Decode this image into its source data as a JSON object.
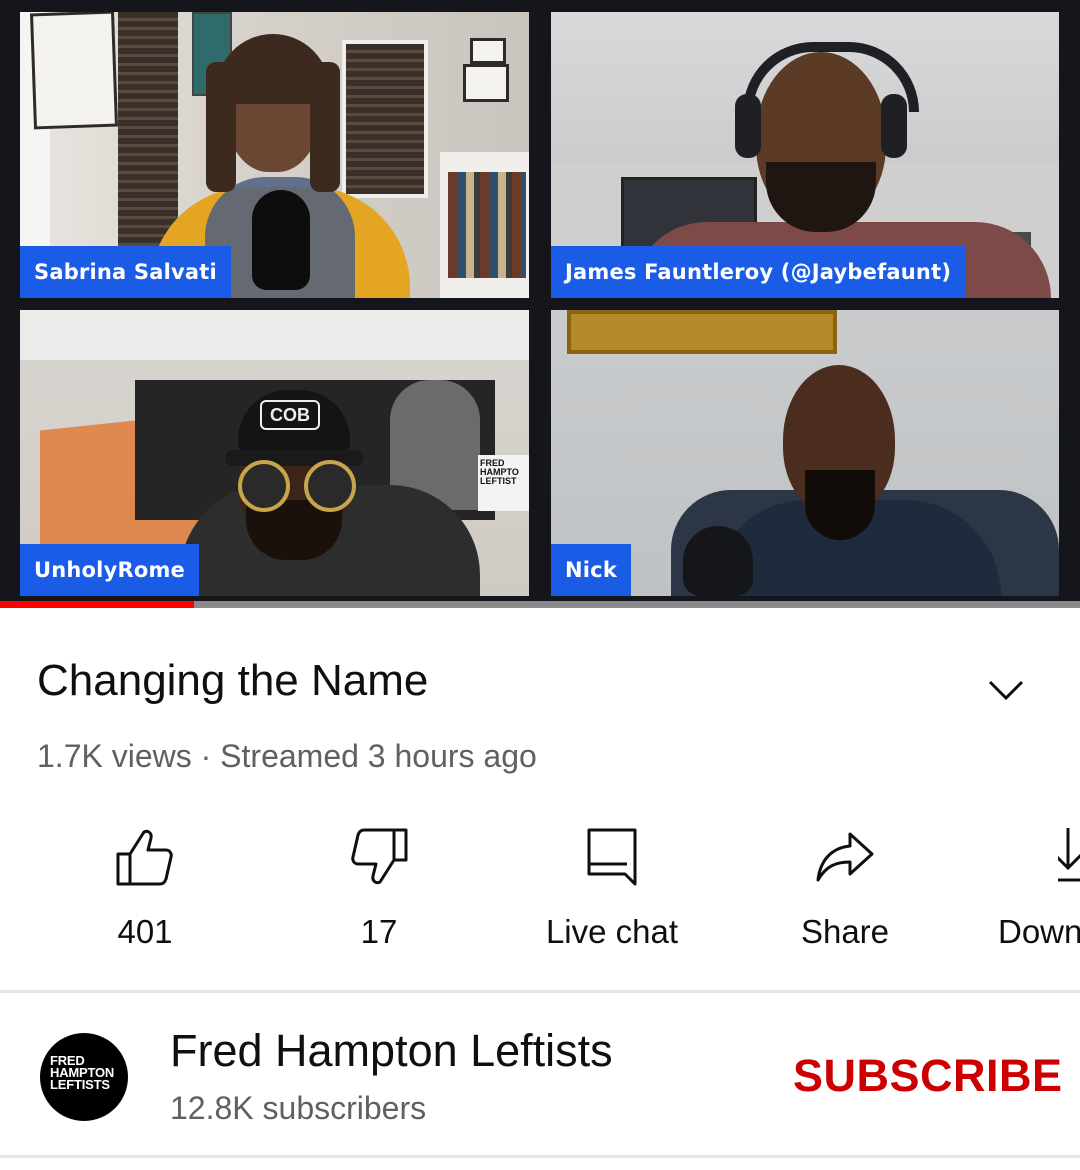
{
  "video": {
    "participants": [
      {
        "name": "Sabrina Salvati"
      },
      {
        "name": "James Fauntleroy (@Jaybefaunt)"
      },
      {
        "name": "UnholyRome"
      },
      {
        "name": "Nick"
      }
    ],
    "cap_text": "COB",
    "poster_text": "FRED HAMPTO LEFTIST",
    "progress_fraction": 0.18,
    "colors": {
      "name_tag": "#1b5ce6",
      "progress": "#ff0000"
    }
  },
  "info": {
    "title": "Changing the Name",
    "views": "1.7K views",
    "separator": "·",
    "streamed": "Streamed 3 hours ago"
  },
  "actions": [
    {
      "icon": "thumbs-up-icon",
      "label": "401"
    },
    {
      "icon": "thumbs-down-icon",
      "label": "17"
    },
    {
      "icon": "live-chat-icon",
      "label": "Live chat"
    },
    {
      "icon": "share-icon",
      "label": "Share"
    },
    {
      "icon": "download-icon",
      "label": "Down"
    }
  ],
  "channel": {
    "name": "Fred Hampton Leftists",
    "subscribers": "12.8K subscribers",
    "avatar_text": "FRED HAMPTON LEFTISTS",
    "subscribe_label": "SUBSCRIBE",
    "subscribe_color": "#cc0000"
  }
}
